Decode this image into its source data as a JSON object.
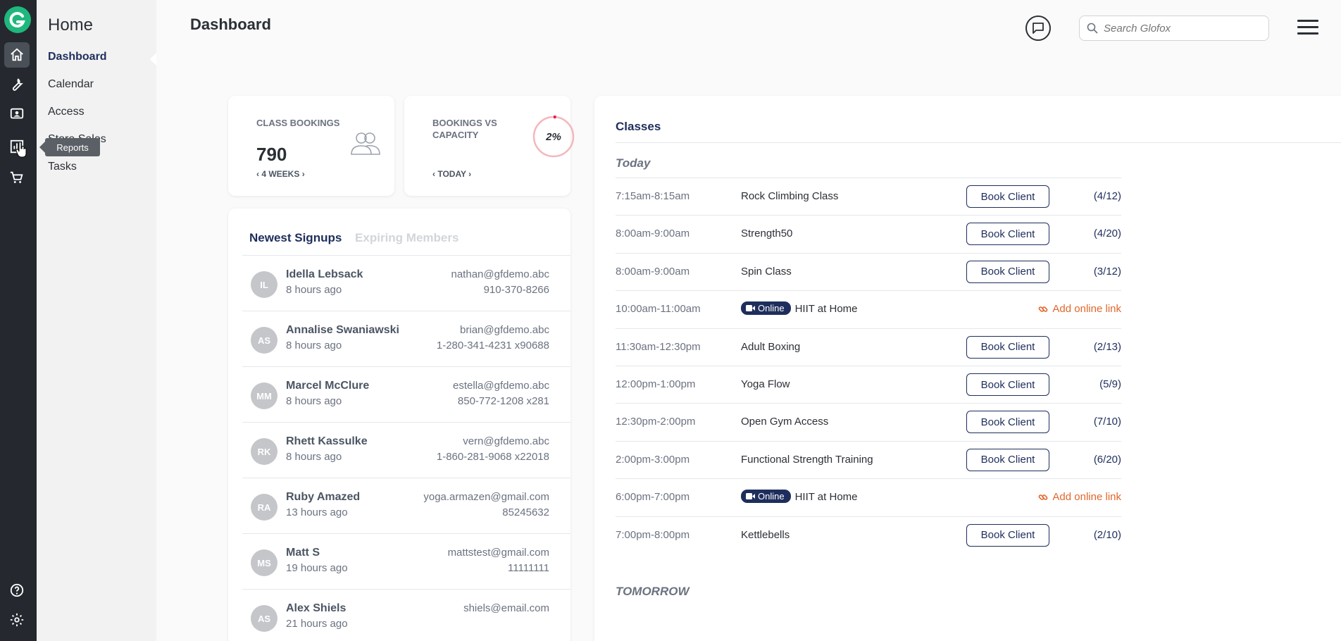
{
  "app": {
    "brand_color": "#1fb77d",
    "rail_items": [
      {
        "name": "home-icon",
        "active": true
      },
      {
        "name": "wrench-icon",
        "active": false
      },
      {
        "name": "member-card-icon",
        "active": false
      },
      {
        "name": "reports-icon",
        "active": false
      },
      {
        "name": "cart-icon",
        "active": false
      }
    ],
    "rail_bottom": [
      "help-icon",
      "gear-icon"
    ],
    "tooltip": "Reports"
  },
  "subnav": {
    "title": "Home",
    "items": [
      {
        "label": "Dashboard",
        "active": true
      },
      {
        "label": "Calendar",
        "active": false
      },
      {
        "label": "Access",
        "active": false
      },
      {
        "label": "Store Sales",
        "active": false
      },
      {
        "label": "Tasks",
        "active": false
      }
    ]
  },
  "header": {
    "title": "Dashboard",
    "search_placeholder": "Search Glofox"
  },
  "stats": {
    "class_bookings": {
      "label": "CLASS BOOKINGS",
      "value": "790",
      "range": "4 WEEKS"
    },
    "bookings_vs_capacity": {
      "label": "BOOKINGS VS CAPACITY",
      "value": "2%",
      "percent": 2,
      "range": "TODAY"
    }
  },
  "signups": {
    "tab_active": "Newest Signups",
    "tab_inactive": "Expiring Members",
    "rows": [
      {
        "initials": "IL",
        "name": "Idella Lebsack",
        "time": "8 hours ago",
        "email": "nathan@gfdemo.abc",
        "phone": "910-370-8266"
      },
      {
        "initials": "AS",
        "name": "Annalise Swaniawski",
        "time": "8 hours ago",
        "email": "brian@gfdemo.abc",
        "phone": "1-280-341-4231 x90688"
      },
      {
        "initials": "MM",
        "name": "Marcel McClure",
        "time": "8 hours ago",
        "email": "estella@gfdemo.abc",
        "phone": "850-772-1208 x281"
      },
      {
        "initials": "RK",
        "name": "Rhett Kassulke",
        "time": "8 hours ago",
        "email": "vern@gfdemo.abc",
        "phone": "1-860-281-9068 x22018"
      },
      {
        "initials": "RA",
        "name": "Ruby Amazed",
        "time": "13 hours ago",
        "email": "yoga.armazen@gmail.com",
        "phone": "85245632"
      },
      {
        "initials": "MS",
        "name": "Matt S",
        "time": "19 hours ago",
        "email": "mattstest@gmail.com",
        "phone": "11111111"
      },
      {
        "initials": "AS",
        "name": "Alex Shiels",
        "time": "21 hours ago",
        "email": "shiels@email.com",
        "phone": ""
      }
    ]
  },
  "classes": {
    "title": "Classes",
    "today_label": "Today",
    "tomorrow_label": "TOMORROW",
    "book_label": "Book Client",
    "online_label": "Online",
    "add_online_label": "Add online link",
    "rows": [
      {
        "time": "7:15am-8:15am",
        "name": "Rock Climbing Class",
        "online": false,
        "capacity": "(4/12)"
      },
      {
        "time": "8:00am-9:00am",
        "name": "Strength50",
        "online": false,
        "capacity": "(4/20)"
      },
      {
        "time": "8:00am-9:00am",
        "name": "Spin Class",
        "online": false,
        "capacity": "(3/12)"
      },
      {
        "time": "10:00am-11:00am",
        "name": "HIIT at Home",
        "online": true,
        "capacity": ""
      },
      {
        "time": "11:30am-12:30pm",
        "name": "Adult Boxing",
        "online": false,
        "capacity": "(2/13)"
      },
      {
        "time": "12:00pm-1:00pm",
        "name": "Yoga Flow",
        "online": false,
        "capacity": "(5/9)"
      },
      {
        "time": "12:30pm-2:00pm",
        "name": "Open Gym Access",
        "online": false,
        "capacity": "(7/10)"
      },
      {
        "time": "2:00pm-3:00pm",
        "name": "Functional Strength Training",
        "online": false,
        "capacity": "(6/20)"
      },
      {
        "time": "6:00pm-7:00pm",
        "name": "HIIT at Home",
        "online": true,
        "capacity": ""
      },
      {
        "time": "7:00pm-8:00pm",
        "name": "Kettlebells",
        "online": false,
        "capacity": "(2/10)"
      }
    ]
  }
}
